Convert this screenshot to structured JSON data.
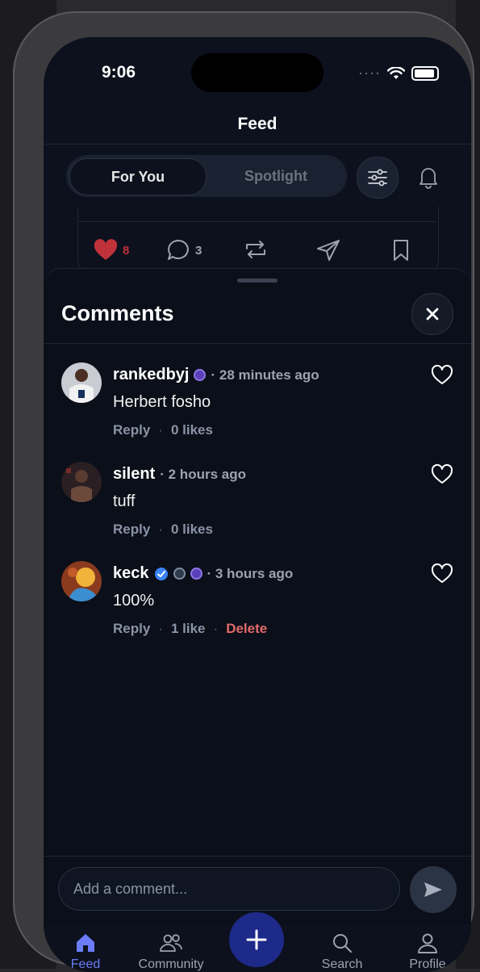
{
  "status_bar": {
    "time": "9:06"
  },
  "header": {
    "title": "Feed"
  },
  "segments": {
    "active": "For You",
    "inactive": "Spotlight"
  },
  "post": {
    "likes": "8",
    "comments": "3"
  },
  "sheet": {
    "title": "Comments"
  },
  "comments": [
    {
      "user": "rankedbyj",
      "time": "· 28 minutes ago",
      "body": "Herbert fosho",
      "reply": "Reply",
      "likes": "0 likes"
    },
    {
      "user": "silent",
      "time": "· 2 hours ago",
      "body": "tuff",
      "reply": "Reply",
      "likes": "0 likes"
    },
    {
      "user": "keck",
      "time": "· 3 hours ago",
      "body": "100%",
      "reply": "Reply",
      "likes": "1 like",
      "delete": "Delete"
    }
  ],
  "composer": {
    "placeholder": "Add a comment..."
  },
  "tabs": [
    {
      "label": "Feed",
      "icon": "home-icon"
    },
    {
      "label": "Community",
      "icon": "people-icon"
    },
    {
      "label": "Search",
      "icon": "search-icon"
    },
    {
      "label": "Profile",
      "icon": "person-icon"
    }
  ],
  "colors": {
    "accent": "#6b7cf6",
    "fab": "#1e2a8a",
    "like_red": "#c0323a",
    "delete": "#e26a6a",
    "verified": "#3b82f6"
  }
}
